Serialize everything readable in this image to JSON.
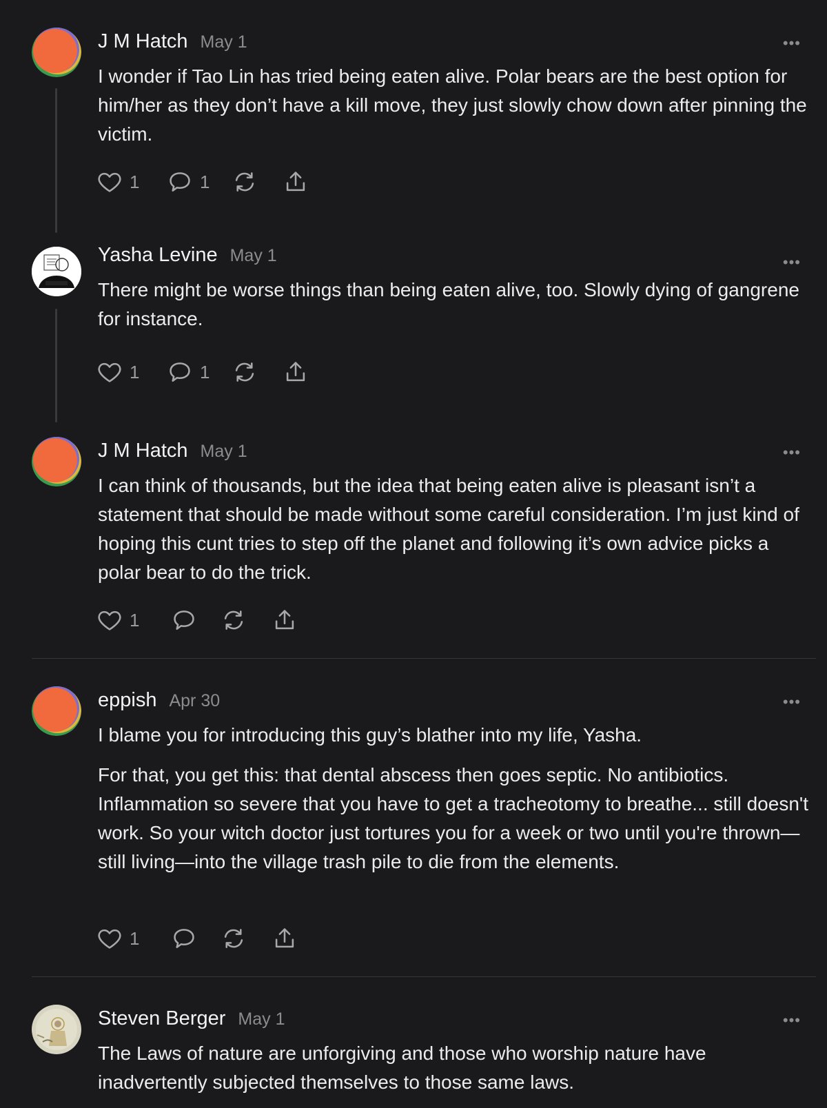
{
  "comments": [
    {
      "author": "J M Hatch",
      "date": "May 1",
      "paragraphs": [
        "I wonder if Tao Lin has tried being eaten alive. Polar bears are the best option for him/her as they don’t have a kill move, they just slowly chow down after pinning the victim."
      ],
      "likes": "1",
      "replies": "1"
    },
    {
      "author": "Yasha Levine",
      "date": "May 1",
      "paragraphs": [
        "There might be worse things than being eaten alive, too. Slowly dying of gangrene for instance."
      ],
      "likes": "1",
      "replies": "1"
    },
    {
      "author": "J M Hatch",
      "date": "May 1",
      "paragraphs": [
        "I can think of thousands, but the idea that being eaten alive is pleasant isn’t a statement that should be made without some careful consideration. I’m just kind of hoping this cunt tries to step off the planet and following it’s own advice picks a polar bear to do the trick."
      ],
      "likes": "1",
      "replies": ""
    },
    {
      "author": "eppish",
      "date": "Apr 30",
      "paragraphs": [
        "I blame you for introducing this guy’s blather into my life, Yasha.",
        "For that, you get this: that dental abscess then goes septic. No antibiotics. Inflammation so severe that you have to get a tracheotomy to breathe... still doesn't work. So your witch doctor just tortures you for a week or two until you're thrown—still living—into the village trash pile to die from the elements."
      ],
      "likes": "1",
      "replies": ""
    },
    {
      "author": "Steven Berger",
      "date": "May 1",
      "paragraphs": [
        "The Laws of nature are unforgiving and those who worship nature have inadvertently subjected themselves to those same laws."
      ],
      "likes": "",
      "replies": ""
    }
  ],
  "more_label": "•••",
  "icons": {
    "like": "heart-icon",
    "reply": "speech-bubble-icon",
    "restack": "restack-icon",
    "share": "share-icon"
  }
}
